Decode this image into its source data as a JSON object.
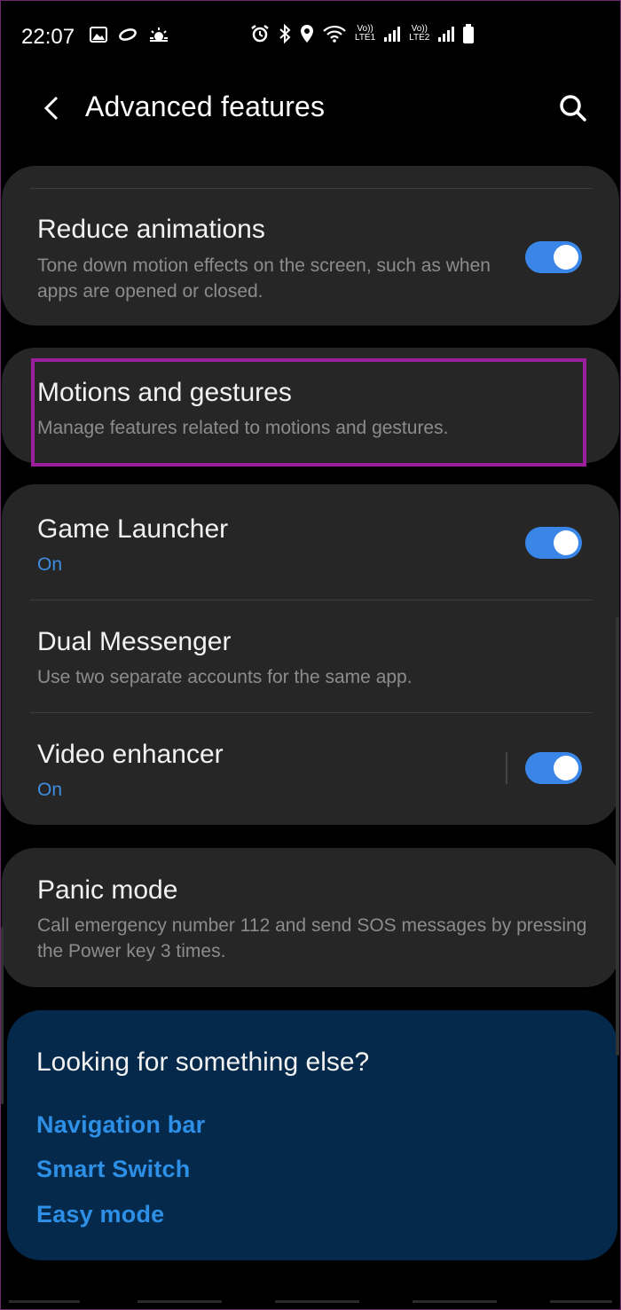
{
  "status_bar": {
    "time": "22:07",
    "sim1_label_top": "Vo))",
    "sim1_label_bottom": "LTE1",
    "sim2_label_top": "Vo))",
    "sim2_label_bottom": "LTE2"
  },
  "header": {
    "title": "Advanced features"
  },
  "items": {
    "reduce_animations": {
      "title": "Reduce animations",
      "subtitle": "Tone down motion effects on the screen, such as when apps are opened or closed.",
      "toggle_on": true
    },
    "motions_gestures": {
      "title": "Motions and gestures",
      "subtitle": "Manage features related to motions and gestures."
    },
    "game_launcher": {
      "title": "Game Launcher",
      "status": "On",
      "toggle_on": true
    },
    "dual_messenger": {
      "title": "Dual Messenger",
      "subtitle": "Use two separate accounts for the same app."
    },
    "video_enhancer": {
      "title": "Video enhancer",
      "status": "On",
      "toggle_on": true
    },
    "panic_mode": {
      "title": "Panic mode",
      "subtitle": "Call emergency number 112 and send SOS messages by pressing the Power key 3 times."
    }
  },
  "suggestions": {
    "title": "Looking for something else?",
    "links": [
      "Navigation bar",
      "Smart Switch",
      "Easy mode"
    ]
  },
  "colors": {
    "accent": "#3a86e8",
    "link": "#2d8fe6",
    "highlight": "#9a1f9a",
    "card": "#262626",
    "suggest_bg": "#05294a"
  }
}
